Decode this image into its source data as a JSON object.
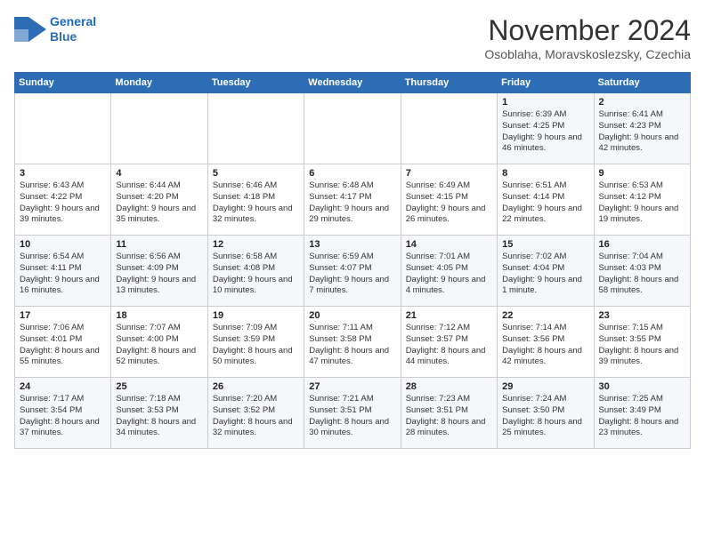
{
  "header": {
    "logo_line1": "General",
    "logo_line2": "Blue",
    "month": "November 2024",
    "location": "Osoblaha, Moravskoslezsky, Czechia"
  },
  "days_of_week": [
    "Sunday",
    "Monday",
    "Tuesday",
    "Wednesday",
    "Thursday",
    "Friday",
    "Saturday"
  ],
  "weeks": [
    [
      {
        "day": "",
        "info": ""
      },
      {
        "day": "",
        "info": ""
      },
      {
        "day": "",
        "info": ""
      },
      {
        "day": "",
        "info": ""
      },
      {
        "day": "",
        "info": ""
      },
      {
        "day": "1",
        "info": "Sunrise: 6:39 AM\nSunset: 4:25 PM\nDaylight: 9 hours and 46 minutes."
      },
      {
        "day": "2",
        "info": "Sunrise: 6:41 AM\nSunset: 4:23 PM\nDaylight: 9 hours and 42 minutes."
      }
    ],
    [
      {
        "day": "3",
        "info": "Sunrise: 6:43 AM\nSunset: 4:22 PM\nDaylight: 9 hours and 39 minutes."
      },
      {
        "day": "4",
        "info": "Sunrise: 6:44 AM\nSunset: 4:20 PM\nDaylight: 9 hours and 35 minutes."
      },
      {
        "day": "5",
        "info": "Sunrise: 6:46 AM\nSunset: 4:18 PM\nDaylight: 9 hours and 32 minutes."
      },
      {
        "day": "6",
        "info": "Sunrise: 6:48 AM\nSunset: 4:17 PM\nDaylight: 9 hours and 29 minutes."
      },
      {
        "day": "7",
        "info": "Sunrise: 6:49 AM\nSunset: 4:15 PM\nDaylight: 9 hours and 26 minutes."
      },
      {
        "day": "8",
        "info": "Sunrise: 6:51 AM\nSunset: 4:14 PM\nDaylight: 9 hours and 22 minutes."
      },
      {
        "day": "9",
        "info": "Sunrise: 6:53 AM\nSunset: 4:12 PM\nDaylight: 9 hours and 19 minutes."
      }
    ],
    [
      {
        "day": "10",
        "info": "Sunrise: 6:54 AM\nSunset: 4:11 PM\nDaylight: 9 hours and 16 minutes."
      },
      {
        "day": "11",
        "info": "Sunrise: 6:56 AM\nSunset: 4:09 PM\nDaylight: 9 hours and 13 minutes."
      },
      {
        "day": "12",
        "info": "Sunrise: 6:58 AM\nSunset: 4:08 PM\nDaylight: 9 hours and 10 minutes."
      },
      {
        "day": "13",
        "info": "Sunrise: 6:59 AM\nSunset: 4:07 PM\nDaylight: 9 hours and 7 minutes."
      },
      {
        "day": "14",
        "info": "Sunrise: 7:01 AM\nSunset: 4:05 PM\nDaylight: 9 hours and 4 minutes."
      },
      {
        "day": "15",
        "info": "Sunrise: 7:02 AM\nSunset: 4:04 PM\nDaylight: 9 hours and 1 minute."
      },
      {
        "day": "16",
        "info": "Sunrise: 7:04 AM\nSunset: 4:03 PM\nDaylight: 8 hours and 58 minutes."
      }
    ],
    [
      {
        "day": "17",
        "info": "Sunrise: 7:06 AM\nSunset: 4:01 PM\nDaylight: 8 hours and 55 minutes."
      },
      {
        "day": "18",
        "info": "Sunrise: 7:07 AM\nSunset: 4:00 PM\nDaylight: 8 hours and 52 minutes."
      },
      {
        "day": "19",
        "info": "Sunrise: 7:09 AM\nSunset: 3:59 PM\nDaylight: 8 hours and 50 minutes."
      },
      {
        "day": "20",
        "info": "Sunrise: 7:11 AM\nSunset: 3:58 PM\nDaylight: 8 hours and 47 minutes."
      },
      {
        "day": "21",
        "info": "Sunrise: 7:12 AM\nSunset: 3:57 PM\nDaylight: 8 hours and 44 minutes."
      },
      {
        "day": "22",
        "info": "Sunrise: 7:14 AM\nSunset: 3:56 PM\nDaylight: 8 hours and 42 minutes."
      },
      {
        "day": "23",
        "info": "Sunrise: 7:15 AM\nSunset: 3:55 PM\nDaylight: 8 hours and 39 minutes."
      }
    ],
    [
      {
        "day": "24",
        "info": "Sunrise: 7:17 AM\nSunset: 3:54 PM\nDaylight: 8 hours and 37 minutes."
      },
      {
        "day": "25",
        "info": "Sunrise: 7:18 AM\nSunset: 3:53 PM\nDaylight: 8 hours and 34 minutes."
      },
      {
        "day": "26",
        "info": "Sunrise: 7:20 AM\nSunset: 3:52 PM\nDaylight: 8 hours and 32 minutes."
      },
      {
        "day": "27",
        "info": "Sunrise: 7:21 AM\nSunset: 3:51 PM\nDaylight: 8 hours and 30 minutes."
      },
      {
        "day": "28",
        "info": "Sunrise: 7:23 AM\nSunset: 3:51 PM\nDaylight: 8 hours and 28 minutes."
      },
      {
        "day": "29",
        "info": "Sunrise: 7:24 AM\nSunset: 3:50 PM\nDaylight: 8 hours and 25 minutes."
      },
      {
        "day": "30",
        "info": "Sunrise: 7:25 AM\nSunset: 3:49 PM\nDaylight: 8 hours and 23 minutes."
      }
    ]
  ]
}
